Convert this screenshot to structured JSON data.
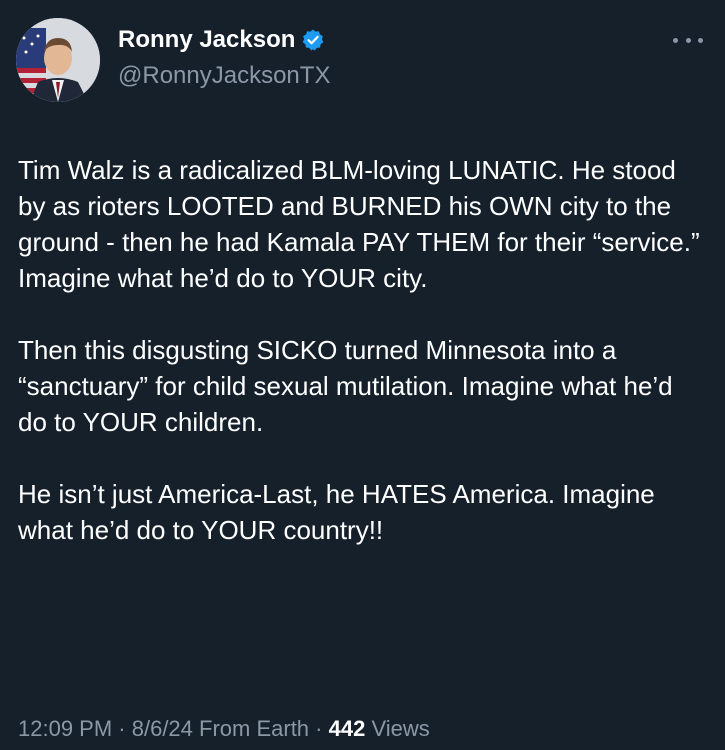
{
  "author": {
    "display_name": "Ronny Jackson",
    "handle": "@RonnyJacksonTX",
    "verified": true
  },
  "tweet": {
    "paragraphs": [
      "Tim Walz is a radicalized BLM-loving LUNATIC. He stood by as rioters LOOTED and BURNED his OWN city to the ground - then he had Kamala PAY THEM for their “service.” Imagine what he’d do to YOUR city.",
      "Then this disgusting SICKO turned Minnesota into a “sanctuary” for child sexual mutilation. Imagine what he’d do to YOUR children.",
      "He isn’t just America-Last, he HATES America. Imagine what he’d do to YOUR country!!"
    ]
  },
  "meta": {
    "time": "12:09 PM",
    "sep1": " · ",
    "date": "8/6/24",
    "source": " From Earth",
    "sep2": " · ",
    "views_count": "442",
    "views_label": " Views"
  },
  "colors": {
    "background": "#15202b",
    "text": "#ffffff",
    "muted": "#8b98a5",
    "verified": "#1d9bf0"
  },
  "icons": {
    "verified": "verified-badge-icon",
    "more": "more-options-icon"
  }
}
